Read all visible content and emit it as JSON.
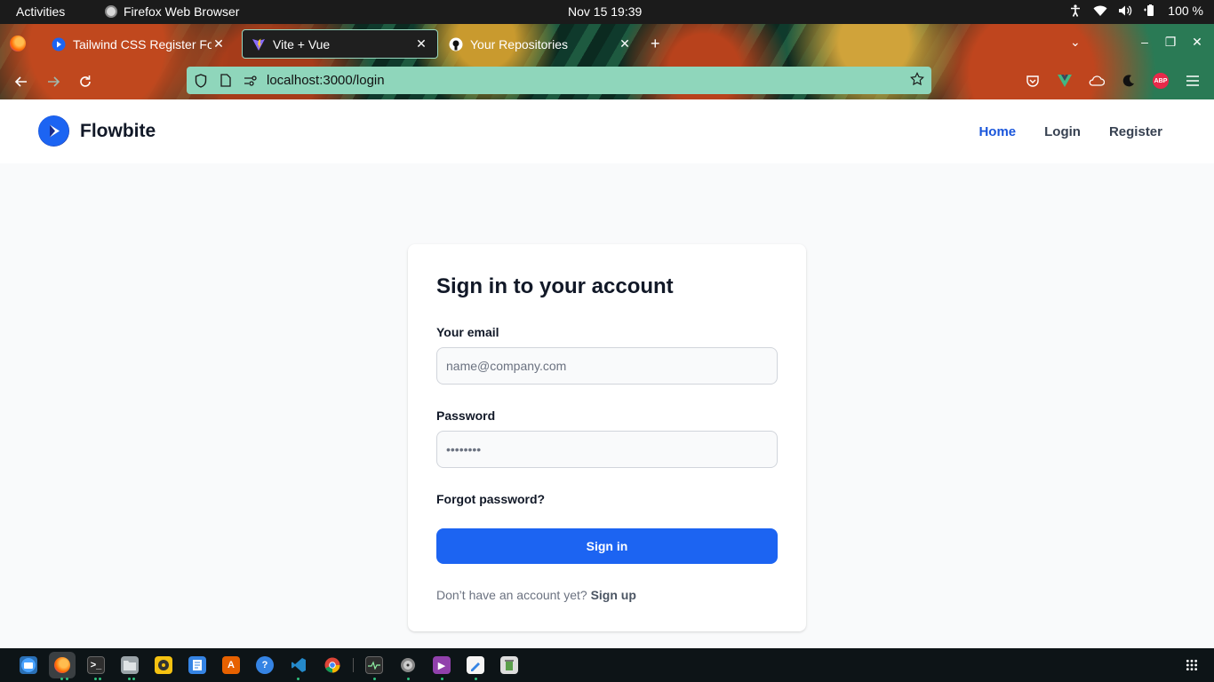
{
  "system_bar": {
    "activities": "Activities",
    "app_name": "Firefox Web Browser",
    "clock": "Nov 15  19:39",
    "battery": "100 %"
  },
  "browser": {
    "tabs": [
      {
        "label": "Tailwind CSS Register For",
        "icon": "tailwind-register-favicon",
        "active": false
      },
      {
        "label": "Vite + Vue",
        "icon": "vite-favicon",
        "active": true
      },
      {
        "label": "Your Repositories",
        "icon": "github-favicon",
        "active": false
      }
    ],
    "url": "localhost:3000/login"
  },
  "site": {
    "brand": "Flowbite",
    "nav": [
      {
        "label": "Home",
        "current": true
      },
      {
        "label": "Login",
        "current": false
      },
      {
        "label": "Register",
        "current": false
      }
    ]
  },
  "login": {
    "title": "Sign in to your account",
    "email_label": "Your email",
    "email_placeholder": "name@company.com",
    "password_label": "Password",
    "password_placeholder": "••••••••",
    "forgot": "Forgot password?",
    "submit": "Sign in",
    "no_account": "Don’t have an account yet?",
    "signup": "Sign up"
  },
  "colors": {
    "primary": "#1c64f2",
    "nav_active": "#1a56db",
    "url_bar": "#8fd6bb"
  },
  "dock": [
    "files-desktop",
    "firefox",
    "terminal",
    "files",
    "rhythmbox",
    "text-editor",
    "app-store",
    "help",
    "vscode",
    "chrome",
    "system-monitor",
    "disks",
    "video",
    "notes",
    "trash"
  ]
}
